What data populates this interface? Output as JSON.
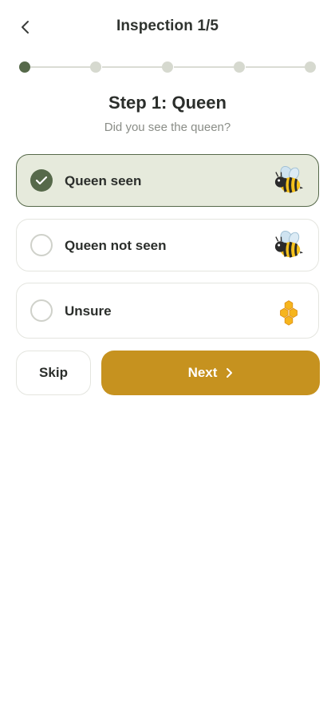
{
  "header": {
    "back_icon": "chevron-left-icon",
    "title": "Inspection 1/5"
  },
  "progress": {
    "total_steps": 5,
    "current_step": 1
  },
  "step": {
    "title": "Step 1: Queen",
    "subtitle": "Did you see the queen?"
  },
  "options": [
    {
      "label": "Queen seen",
      "selected": true,
      "icon": "bee-icon"
    },
    {
      "label": "Queen not seen",
      "selected": false,
      "icon": "bee-icon"
    },
    {
      "label": "Unsure",
      "selected": false,
      "icon": "honeycomb-icon"
    }
  ],
  "actions": {
    "skip_label": "Skip",
    "next_label": "Next",
    "next_icon": "chevron-right-icon"
  },
  "colors": {
    "accent_green": "#56694a",
    "selected_bg": "#e6eadc",
    "primary_button": "#c6921f",
    "honeycomb": "#f2b21b"
  }
}
